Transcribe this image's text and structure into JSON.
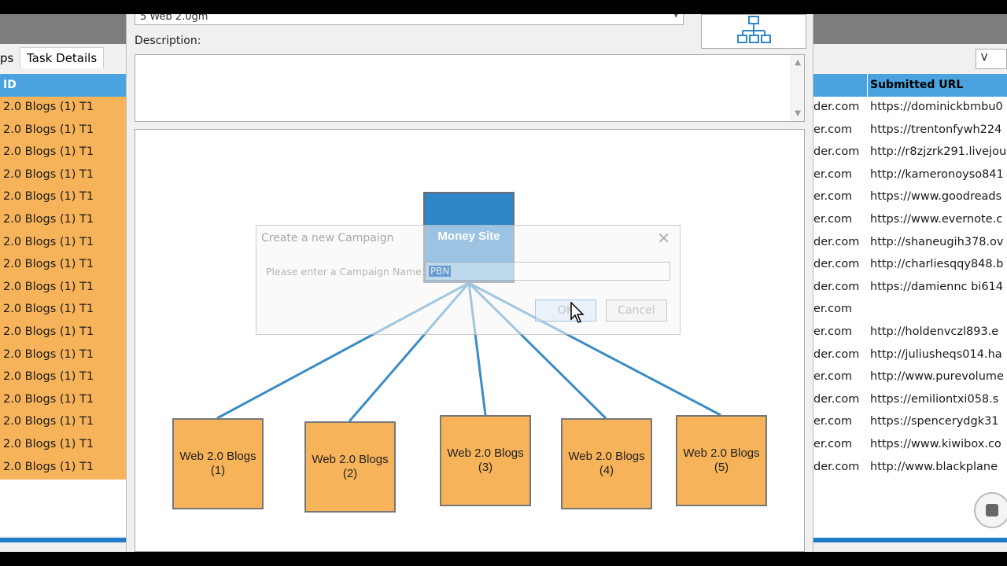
{
  "app": {
    "tabs": [
      {
        "label": "ps"
      },
      {
        "label": "Task Details"
      }
    ],
    "left_header": "ID",
    "task_rows": [
      "2.0 Blogs (1) T1",
      "2.0 Blogs (1) T1",
      "2.0 Blogs (1) T1",
      "2.0 Blogs (1) T1",
      "2.0 Blogs (1) T1",
      "2.0 Blogs (1) T1",
      "2.0 Blogs (1) T1",
      "2.0 Blogs (1) T1",
      "2.0 Blogs (1) T1",
      "2.0 Blogs (1) T1",
      "2.0 Blogs (1) T1",
      "2.0 Blogs (1) T1",
      "2.0 Blogs (1) T1",
      "2.0 Blogs (1) T1",
      "2.0 Blogs (1) T1",
      "2.0 Blogs (1) T1",
      "2.0 Blogs (1) T1"
    ],
    "right_button": "V",
    "right_header": "Submitted URL",
    "url_rows": [
      {
        "domain": "der.com",
        "url": "https://dominickbmbu0"
      },
      {
        "domain": "er.com",
        "url": "https://trentonfywh224"
      },
      {
        "domain": "der.com",
        "url": "http://r8zjzrk291.livejou"
      },
      {
        "domain": "er.com",
        "url": "http://kameronoyso841"
      },
      {
        "domain": "er.com",
        "url": "https://www.goodreads"
      },
      {
        "domain": "er.com",
        "url": "https://www.evernote.c"
      },
      {
        "domain": "der.com",
        "url": "http://shaneugih378.ov"
      },
      {
        "domain": "der.com",
        "url": "http://charliesqqy848.b"
      },
      {
        "domain": "der.com",
        "url": "https://damiennc bi614"
      },
      {
        "domain": "er.com",
        "url": ""
      },
      {
        "domain": "er.com",
        "url": "http://holdenvczl893.e"
      },
      {
        "domain": "der.com",
        "url": "http://juliusheqs014.ha"
      },
      {
        "domain": "er.com",
        "url": "http://www.purevolume"
      },
      {
        "domain": "der.com",
        "url": "https://emiliontxi058.s"
      },
      {
        "domain": "er.com",
        "url": "https://spencerydgk31"
      },
      {
        "domain": "er.com",
        "url": "https://www.kiwibox.co"
      },
      {
        "domain": "der.com",
        "url": "http://www.blackplane"
      }
    ]
  },
  "dialog": {
    "template_value": "5 Web 2.0gm",
    "description_label": "Description:",
    "diagram": {
      "root": "Money Site",
      "nodes": [
        {
          "line1": "Web 2.0 Blogs",
          "line2": "(1)"
        },
        {
          "line1": "Web 2.0 Blogs",
          "line2": "(2)"
        },
        {
          "line1": "Web 2.0 Blogs",
          "line2": "(3)"
        },
        {
          "line1": "Web 2.0 Blogs",
          "line2": "(4)"
        },
        {
          "line1": "Web 2.0 Blogs",
          "line2": "(5)"
        }
      ]
    }
  },
  "modal": {
    "title": "Create a new Campaign",
    "close": "✕",
    "prompt": "Please enter a Campaign Name:",
    "name_value": "PBN",
    "ok_label": "OK",
    "cancel_label": "Cancel"
  },
  "colors": {
    "header_blue": "#4aa3df",
    "tier_orange": "#f7b35a",
    "money_blue": "#2f87c9",
    "link_blue": "#3a8cc4"
  }
}
